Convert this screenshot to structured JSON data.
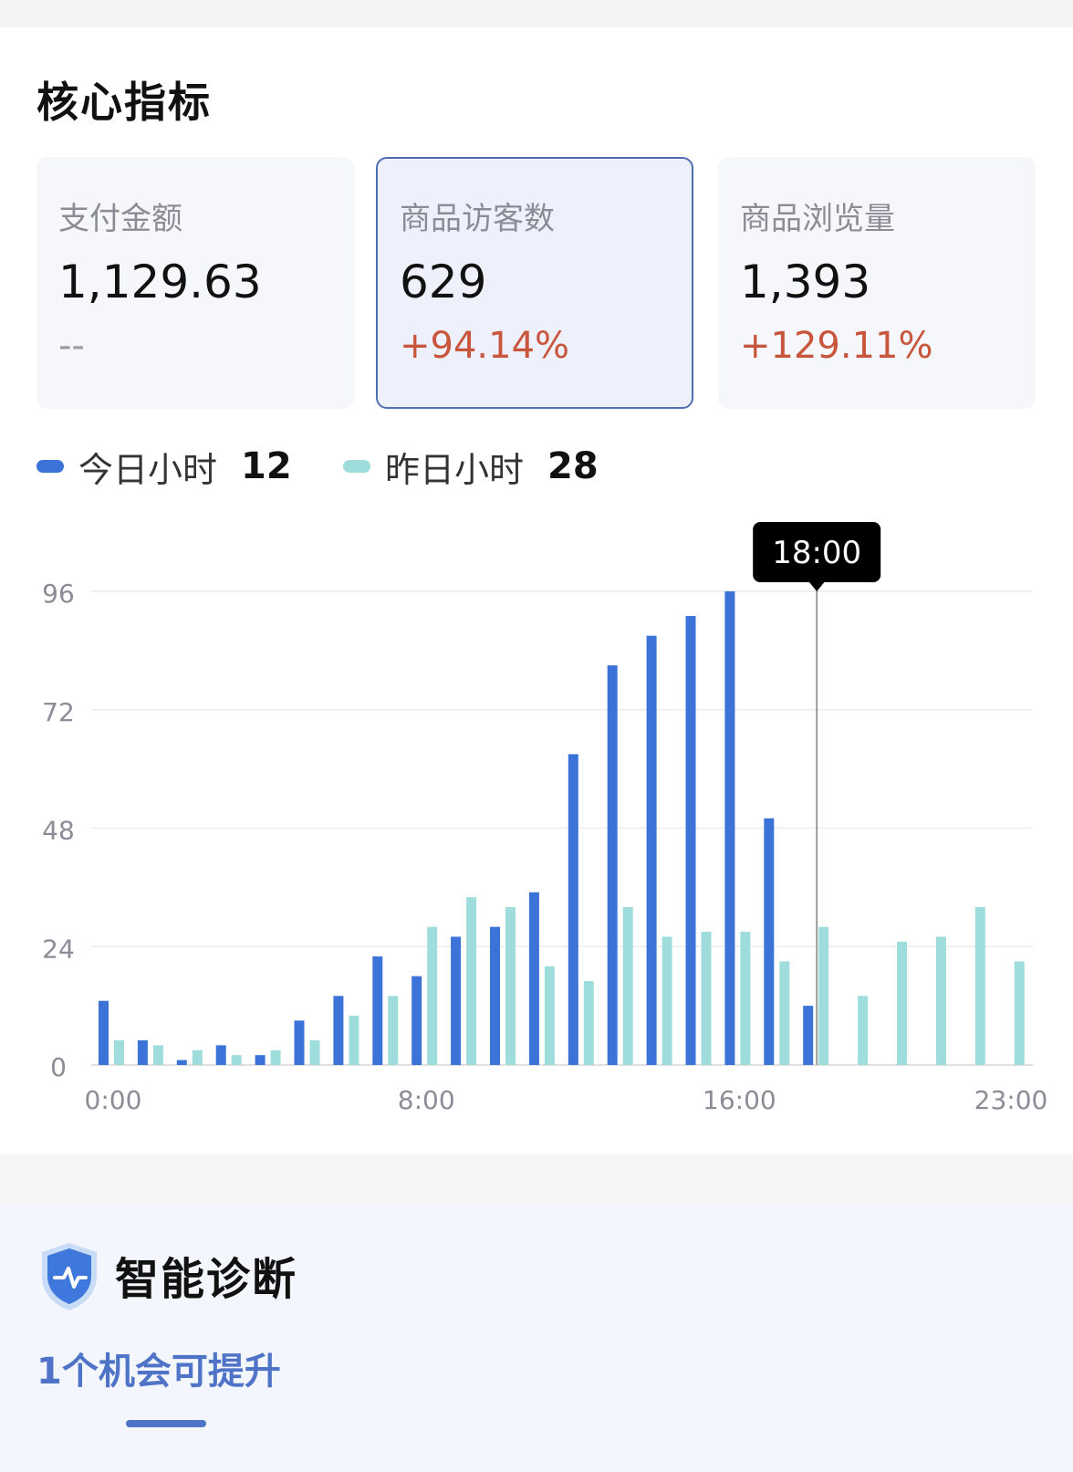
{
  "section_title": "核心指标",
  "metrics": [
    {
      "label": "支付金额",
      "value": "1,129.63",
      "change": "--",
      "selected": false
    },
    {
      "label": "商品访客数",
      "value": "629",
      "change": "+94.14%",
      "selected": true
    },
    {
      "label": "商品浏览量",
      "value": "1,393",
      "change": "+129.11%",
      "selected": false
    }
  ],
  "legend": [
    {
      "name": "今日小时",
      "value": "12",
      "color": "#3b73d8"
    },
    {
      "name": "昨日小时",
      "value": "28",
      "color": "#9fdcdc"
    }
  ],
  "tooltip": "18:00",
  "colors": {
    "accent": "#4f73c6",
    "positive_change": "#c8563d",
    "selected_border": "#4f6fb2"
  },
  "chart_data": {
    "type": "bar",
    "x_tick_labels": [
      "0:00",
      "8:00",
      "16:00",
      "23:00"
    ],
    "x_tick_hours": [
      0,
      8,
      16,
      23
    ],
    "y_ticks": [
      0,
      24,
      48,
      72,
      96
    ],
    "ylim": [
      0,
      96
    ],
    "grid": true,
    "highlight_hour": 18,
    "series": [
      {
        "name": "今日小时",
        "color": "#3b73d8",
        "values": [
          13,
          5,
          1,
          4,
          2,
          9,
          14,
          22,
          18,
          26,
          28,
          35,
          63,
          81,
          87,
          91,
          96,
          50,
          12
        ]
      },
      {
        "name": "昨日小时",
        "color": "#9fdcdc",
        "values": [
          5,
          4,
          3,
          2,
          3,
          5,
          10,
          14,
          28,
          34,
          32,
          20,
          17,
          32,
          26,
          27,
          27,
          21,
          28,
          14,
          25,
          26,
          32,
          21
        ]
      }
    ]
  },
  "diagnosis": {
    "title": "智能诊断",
    "subtitle": "1个机会可提升"
  }
}
